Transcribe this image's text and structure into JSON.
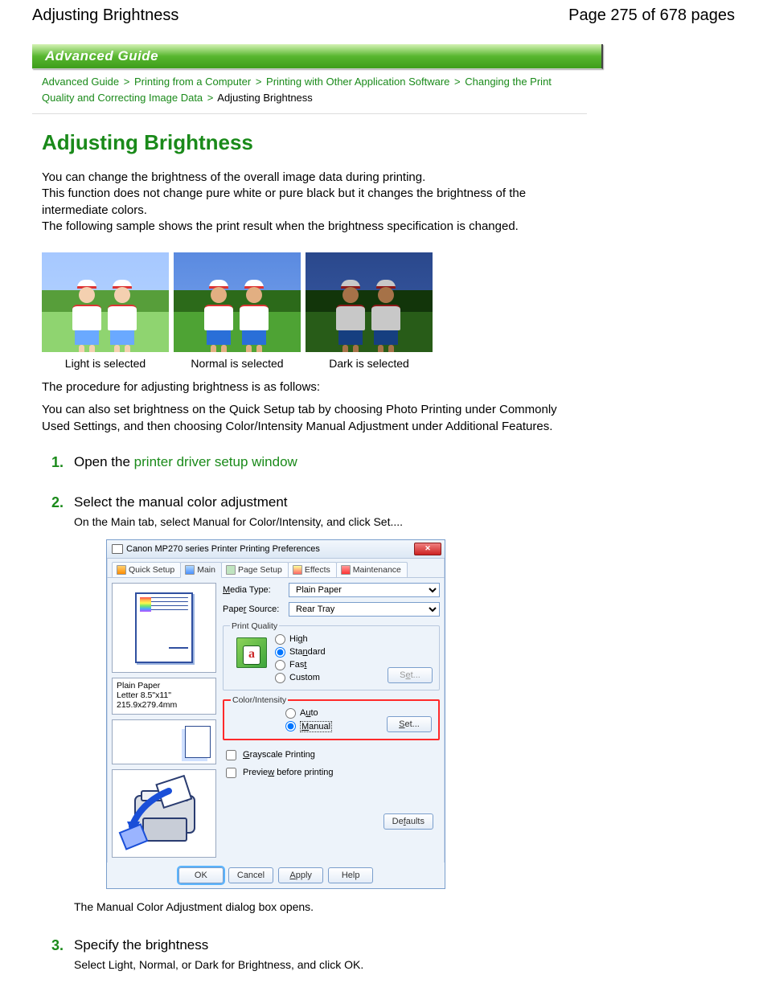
{
  "page_header": {
    "title_left": "Adjusting Brightness",
    "title_right": "Page 275 of 678 pages"
  },
  "banner": "Advanced Guide",
  "breadcrumb": {
    "l1": "Advanced Guide",
    "sep": ">",
    "l2": "Printing from a Computer",
    "l3": "Printing with Other Application Software",
    "l4": "Changing the Print Quality and Correcting Image Data",
    "current": "Adjusting Brightness"
  },
  "heading": "Adjusting Brightness",
  "intro": {
    "p1": "You can change the brightness of the overall image data during printing.",
    "p2": "This function does not change pure white or pure black but it changes the brightness of the intermediate colors.",
    "p3": "The following sample shows the print result when the brightness specification is changed."
  },
  "samples": {
    "light": "Light is selected",
    "normal": "Normal is selected",
    "dark": "Dark is selected"
  },
  "after_samples": {
    "p1": "The procedure for adjusting brightness is as follows:",
    "p2": "You can also set brightness on the Quick Setup tab by choosing Photo Printing under Commonly Used Settings, and then choosing Color/Intensity Manual Adjustment under Additional Features."
  },
  "steps": {
    "s1": {
      "num": "1.",
      "pre": "Open the ",
      "link": "printer driver setup window"
    },
    "s2": {
      "num": "2.",
      "heading": "Select the manual color adjustment",
      "sub": "On the Main tab, select Manual for Color/Intensity, and click Set....",
      "after": "The Manual Color Adjustment dialog box opens."
    },
    "s3": {
      "num": "3.",
      "heading": "Specify the brightness",
      "sub": "Select Light, Normal, or Dark for Brightness, and click OK."
    }
  },
  "dlg": {
    "title": "Canon MP270 series Printer Printing Preferences",
    "close": "✕",
    "tabs": {
      "quick": "Quick Setup",
      "main": "Main",
      "page": "Page Setup",
      "effects": "Effects",
      "maint": "Maintenance"
    },
    "media_lbl": "Media Type:",
    "media_val": "Plain Paper",
    "source_lbl": "Paper Source:",
    "source_val": "Rear Tray",
    "paper_info_1": "Plain Paper",
    "paper_info_2": "Letter 8.5\"x11\" 215.9x279.4mm",
    "quality": {
      "legend": "Print Quality",
      "high": "High",
      "standard": "Standard",
      "fast": "Fast",
      "custom": "Custom",
      "set": "Set...",
      "icon_letter": "a"
    },
    "ci": {
      "legend": "Color/Intensity",
      "auto": "Auto",
      "manual": "Manual",
      "set": "Set..."
    },
    "grayscale": "Grayscale Printing",
    "preview": "Preview before printing",
    "defaults": "Defaults",
    "footer": {
      "ok": "OK",
      "cancel": "Cancel",
      "apply": "Apply",
      "help": "Help"
    }
  }
}
